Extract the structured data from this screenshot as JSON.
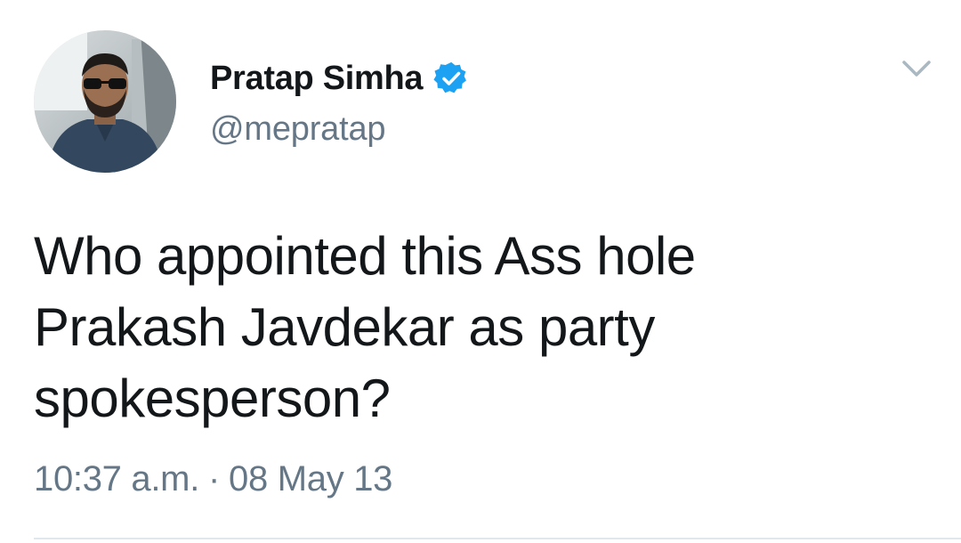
{
  "author": {
    "display_name": "Pratap Simha",
    "handle": "@mepratap",
    "verified": true,
    "verified_icon": "verified-badge-icon",
    "avatar_icon": "profile-photo"
  },
  "tweet": {
    "lines": [
      "Who appointed this Ass hole",
      "Prakash Javdekar as party",
      "spokesperson?"
    ]
  },
  "meta": {
    "time": "10:37 a.m.",
    "separator": "·",
    "date": "08 May 13"
  },
  "menu": {
    "icon": "chevron-down-icon"
  },
  "colors": {
    "text_primary": "#14171a",
    "text_secondary": "#657786",
    "verified_blue": "#1da1f2",
    "divider": "#e1e8ed"
  }
}
